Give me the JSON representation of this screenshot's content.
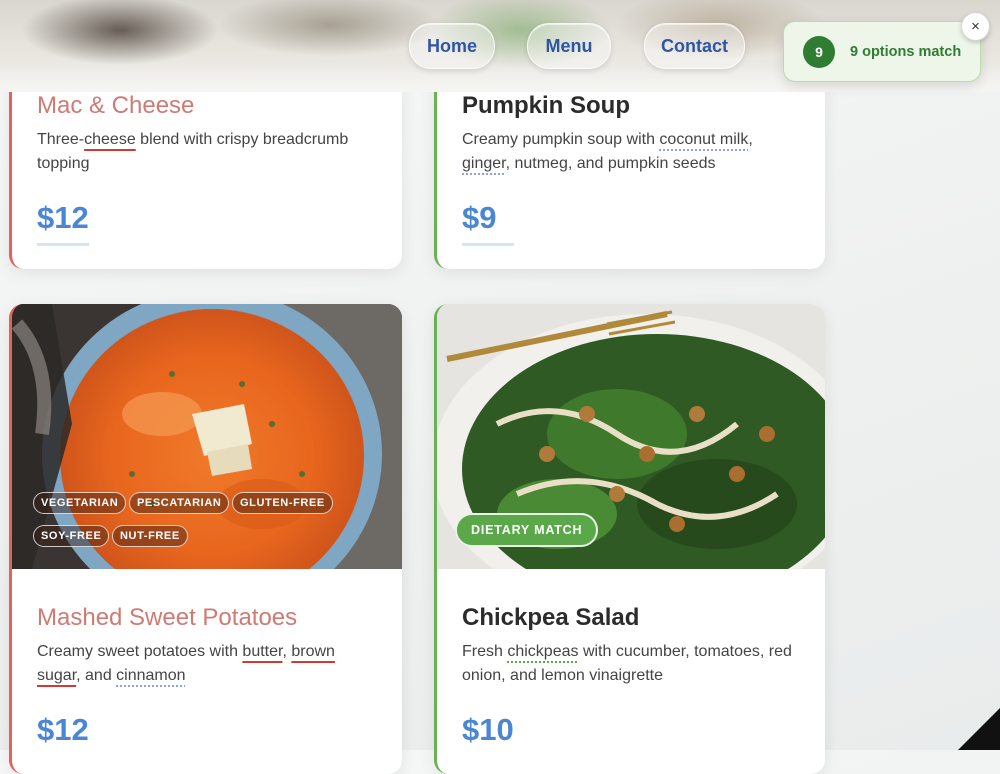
{
  "nav": {
    "home": "Home",
    "menu": "Menu",
    "contact": "Contact"
  },
  "toast": {
    "count": "9",
    "text": "9 options match",
    "close": "×"
  },
  "cards": {
    "mac": {
      "title": "Mac & Cheese",
      "desc_pre": "Three-",
      "desc_hl": "cheese",
      "desc_post": " blend with crispy breadcrumb topping",
      "price": "$12"
    },
    "soup": {
      "title": "Pumpkin Soup",
      "desc_pre": "Creamy pumpkin soup with ",
      "desc_hl1": "coconut milk",
      "desc_mid": ", ",
      "desc_hl2": "ginger",
      "desc_post": ", nutmeg, and pumpkin seeds",
      "price": "$9"
    },
    "potatoes": {
      "title": "Mashed Sweet Potatoes",
      "tags": [
        "VEGETARIAN",
        "PESCATARIAN",
        "GLUTEN-FREE",
        "SOY-FREE",
        "NUT-FREE"
      ],
      "desc_pre": "Creamy sweet potatoes with ",
      "desc_hl1": "butter",
      "desc_mid1": ", ",
      "desc_hl2": "brown sugar",
      "desc_mid2": ", and ",
      "desc_hl3": "cinnamon",
      "price": "$12"
    },
    "salad": {
      "title": "Chickpea Salad",
      "badge": "DIETARY MATCH",
      "desc_pre": "Fresh ",
      "desc_hl": "chickpeas",
      "desc_post": " with cucumber, tomatoes, red onion, and lemon vinaigrette",
      "price": "$10"
    }
  },
  "colors": {
    "accent_blue": "#4a86d4",
    "nav_text": "#2f55a8",
    "match_green": "#5aa84a",
    "warn_red": "#e0635e"
  }
}
